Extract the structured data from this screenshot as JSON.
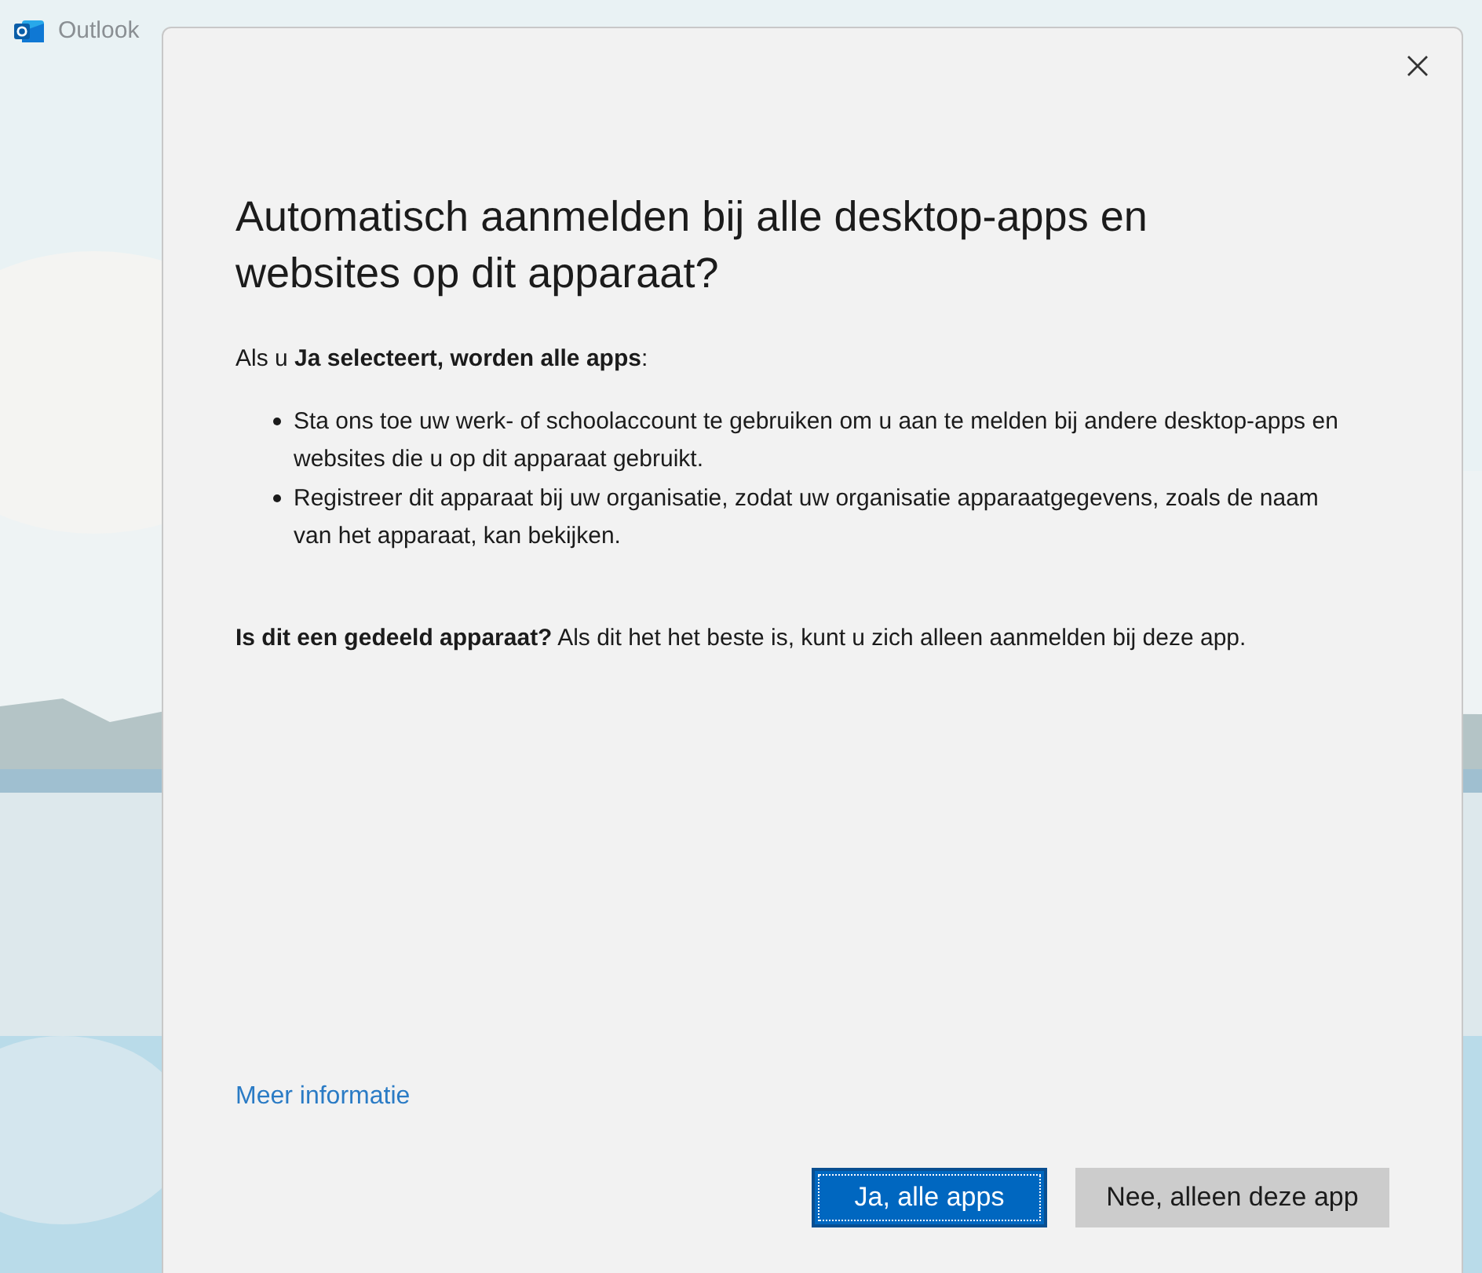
{
  "app_window": {
    "title": "Outlook"
  },
  "dialog": {
    "heading": "Automatisch aanmelden bij alle desktop-apps en websites op dit apparaat?",
    "intro": "Als u **Ja selecteert, worden alle apps**:",
    "bullets": [
      "Sta ons toe uw werk- of schoolaccount te gebruiken om u aan te melden bij andere desktop-apps en websites die u op dit apparaat gebruikt.",
      "Registreer dit apparaat bij uw organisatie, zodat uw organisatie apparaatgegevens, zoals de naam van het apparaat, kan bekijken."
    ],
    "note": "**Is dit een gedeeld apparaat?** Als dit het het beste is, kunt u zich alleen aanmelden bij deze app.",
    "link": "Meer informatie",
    "buttons": [
      {
        "label": "Ja, alle apps",
        "kind": "primary"
      },
      {
        "label": "Nee, alleen deze app",
        "kind": "secondary"
      }
    ]
  }
}
